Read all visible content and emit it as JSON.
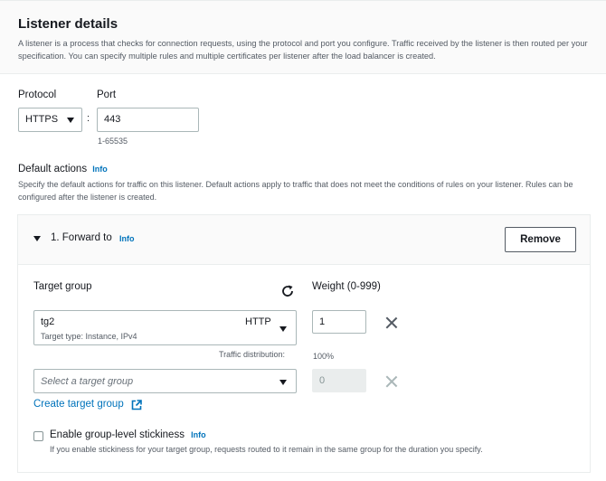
{
  "header": {
    "title": "Listener details",
    "description": "A listener is a process that checks for connection requests, using the protocol and port you configure. Traffic received by the listener is then routed per your specification. You can specify multiple rules and multiple certificates per listener after the load balancer is created."
  },
  "protocol": {
    "label": "Protocol",
    "value": "HTTPS"
  },
  "separator": ":",
  "port": {
    "label": "Port",
    "value": "443",
    "hint": "1-65535"
  },
  "default_actions": {
    "label": "Default actions",
    "info": "Info",
    "description": "Specify the default actions for traffic on this listener. Default actions apply to traffic that does not meet the conditions of rules on your listener. Rules can be configured after the listener is created."
  },
  "rule": {
    "title": "1. Forward to",
    "info": "Info",
    "remove_label": "Remove",
    "target_group_label": "Target group",
    "weight_label": "Weight (0-999)",
    "groups": [
      {
        "name": "tg2",
        "protocol": "HTTP",
        "detail": "Target type: Instance, IPv4",
        "weight": "1"
      }
    ],
    "traffic_label": "Traffic distribution:",
    "traffic_value": "100%",
    "new_group_placeholder": "Select a target group",
    "new_group_weight": "0",
    "create_link": "Create target group",
    "stickiness_label": "Enable group-level stickiness",
    "stickiness_info": "Info",
    "stickiness_hint": "If you enable stickiness for your target group, requests routed to it remain in the same group for the duration you specify."
  },
  "icons": {
    "refresh": "refresh-icon",
    "remove": "close-icon",
    "external": "external-link-icon",
    "expand": "caret-down-icon"
  },
  "colors": {
    "link": "#0073bb",
    "text": "#16191f",
    "muted": "#545b64",
    "border": "#aab7b8"
  }
}
